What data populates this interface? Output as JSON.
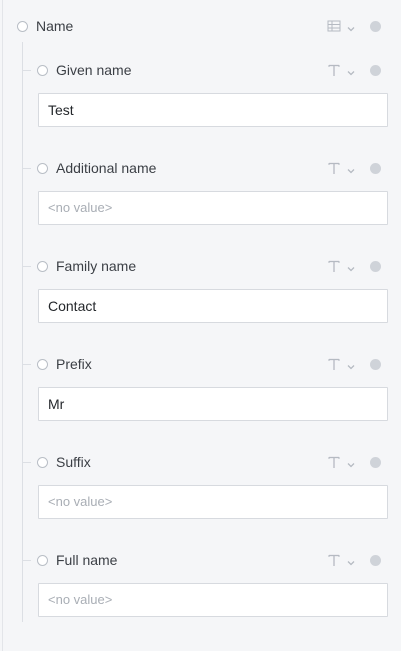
{
  "root": {
    "label": "Name",
    "type_icon": "table-icon"
  },
  "fields": [
    {
      "label": "Given name",
      "value": "Test",
      "placeholder": "<no value>",
      "type_icon": "text-type-icon"
    },
    {
      "label": "Additional name",
      "value": "",
      "placeholder": "<no value>",
      "type_icon": "text-type-icon"
    },
    {
      "label": "Family name",
      "value": "Contact",
      "placeholder": "<no value>",
      "type_icon": "text-type-icon"
    },
    {
      "label": "Prefix",
      "value": "Mr",
      "placeholder": "<no value>",
      "type_icon": "text-type-icon"
    },
    {
      "label": "Suffix",
      "value": "",
      "placeholder": "<no value>",
      "type_icon": "text-type-icon"
    },
    {
      "label": "Full name",
      "value": "",
      "placeholder": "<no value>",
      "type_icon": "text-type-icon"
    }
  ]
}
